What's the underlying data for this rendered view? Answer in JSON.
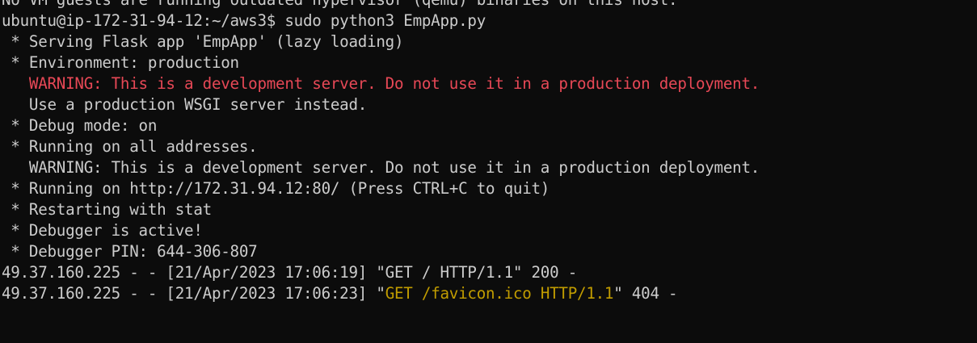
{
  "colors": {
    "background": "#0c0c0c",
    "default_text": "#cccccc",
    "red": "#e74856",
    "yellow": "#c19c00"
  },
  "terminal": {
    "lines": [
      {
        "segments": [
          {
            "text": "No VM guests are running outdated hypervisor (qemu) binaries on this host.",
            "color": "default"
          }
        ]
      },
      {
        "segments": [
          {
            "text": "ubuntu@ip-172-31-94-12:~/aws3$ sudo python3 EmpApp.py",
            "color": "default"
          }
        ]
      },
      {
        "segments": [
          {
            "text": " * Serving Flask app 'EmpApp' (lazy loading)",
            "color": "default"
          }
        ]
      },
      {
        "segments": [
          {
            "text": " * Environment: production",
            "color": "default"
          }
        ]
      },
      {
        "segments": [
          {
            "text": "   WARNING: This is a development server. Do not use it in a production deployment.",
            "color": "red"
          }
        ]
      },
      {
        "segments": [
          {
            "text": "   Use a production WSGI server instead.",
            "color": "default"
          }
        ]
      },
      {
        "segments": [
          {
            "text": " * Debug mode: on",
            "color": "default"
          }
        ]
      },
      {
        "segments": [
          {
            "text": " * Running on all addresses.",
            "color": "default"
          }
        ]
      },
      {
        "segments": [
          {
            "text": "   WARNING: This is a development server. Do not use it in a production deployment.",
            "color": "default"
          }
        ]
      },
      {
        "segments": [
          {
            "text": " * Running on http://172.31.94.12:80/ (Press CTRL+C to quit)",
            "color": "default"
          }
        ]
      },
      {
        "segments": [
          {
            "text": " * Restarting with stat",
            "color": "default"
          }
        ]
      },
      {
        "segments": [
          {
            "text": " * Debugger is active!",
            "color": "default"
          }
        ]
      },
      {
        "segments": [
          {
            "text": " * Debugger PIN: 644-306-807",
            "color": "default"
          }
        ]
      },
      {
        "segments": [
          {
            "text": "49.37.160.225 - - [21/Apr/2023 17:06:19] \"GET / HTTP/1.1\" 200 -",
            "color": "default"
          }
        ]
      },
      {
        "segments": [
          {
            "text": "49.37.160.225 - - [21/Apr/2023 17:06:23] \"",
            "color": "default"
          },
          {
            "text": "GET /favicon.ico HTTP/1.1",
            "color": "yellow"
          },
          {
            "text": "\" 404 -",
            "color": "default"
          }
        ]
      }
    ]
  }
}
